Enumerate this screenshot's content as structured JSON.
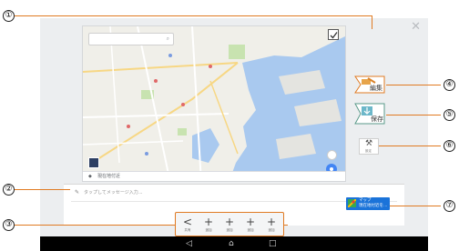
{
  "callouts": [
    "①",
    "②",
    "③",
    "④",
    "⑤",
    "⑥",
    "⑦"
  ],
  "map": {
    "location_label": "現在地付近"
  },
  "side_buttons": {
    "edit_label": "編集",
    "save_label": "保存",
    "settings_label": "設定"
  },
  "message": {
    "placeholder": "タップしてメッセージ入力..."
  },
  "map_cta": {
    "line1": "マップ",
    "line2": "現在地付近を…"
  },
  "toolbar": {
    "items": [
      {
        "icon": "<",
        "label": "共有"
      },
      {
        "icon": "+",
        "label": "追加"
      },
      {
        "icon": "+",
        "label": "追加"
      },
      {
        "icon": "+",
        "label": "追加"
      },
      {
        "icon": "+",
        "label": "追加"
      }
    ]
  },
  "navbar": {
    "back": "◁",
    "home": "⌂",
    "recent": "□"
  },
  "colors": {
    "accent": "#e07a22",
    "map_water": "#a9c9ef",
    "map_park": "#c8e3b0",
    "cta_blue": "#1a73d9"
  }
}
